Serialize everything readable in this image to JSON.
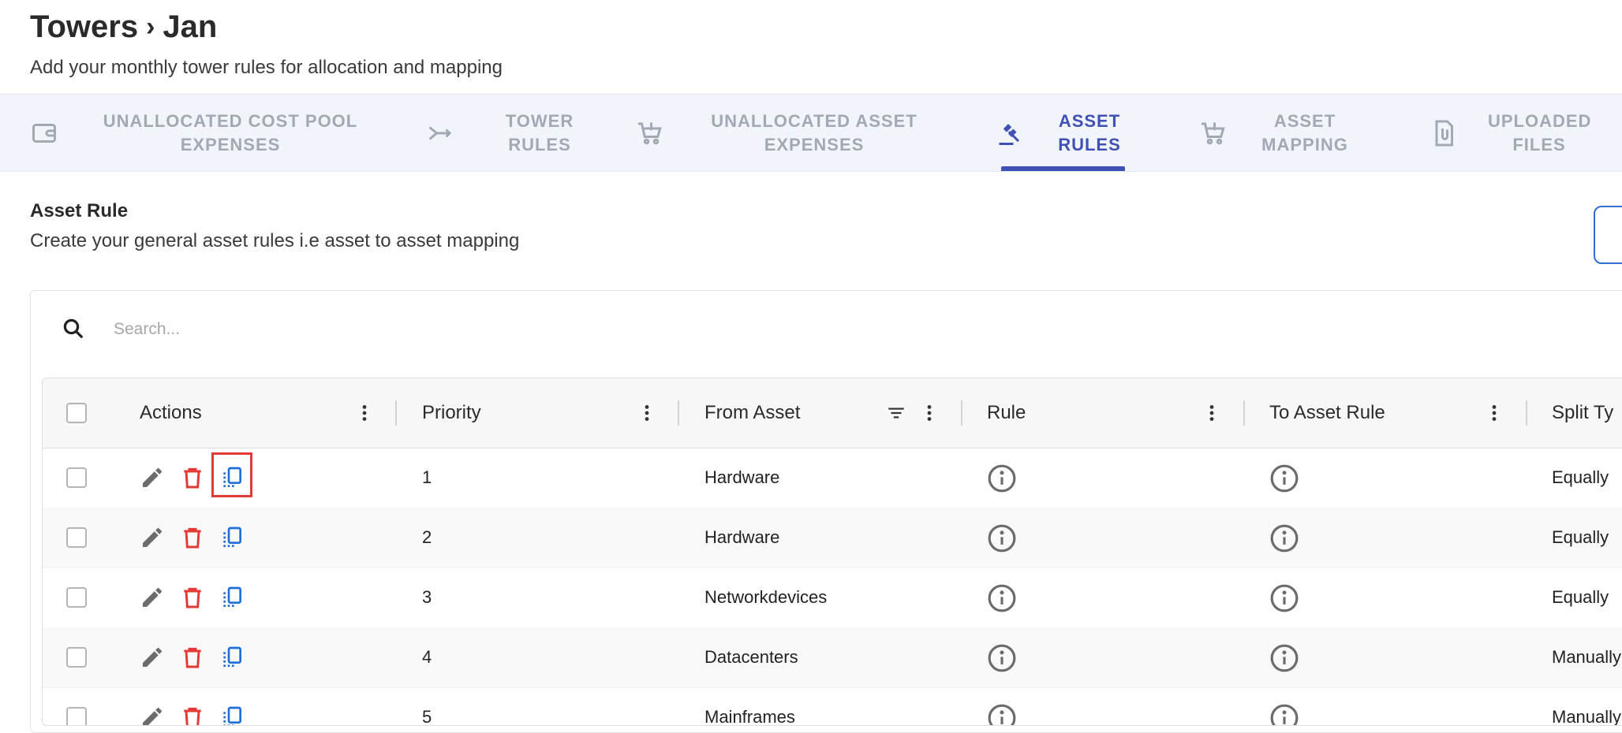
{
  "header": {
    "breadcrumb_parent": "Towers",
    "breadcrumb_separator": "›",
    "breadcrumb_current": "Jan",
    "subtitle": "Add your monthly tower rules for allocation and mapping"
  },
  "tabs": [
    {
      "line1": "UNALLOCATED COST POOL",
      "line2": "EXPENSES",
      "icon": "wallet-icon",
      "active": false
    },
    {
      "line1": "TOWER",
      "line2": "RULES",
      "icon": "merge-arrow-icon",
      "active": false
    },
    {
      "line1": "UNALLOCATED ASSET",
      "line2": "EXPENSES",
      "icon": "cart-alert-icon",
      "active": false
    },
    {
      "line1": "ASSET",
      "line2": "RULES",
      "icon": "gavel-icon",
      "active": true
    },
    {
      "line1": "ASSET",
      "line2": "MAPPING",
      "icon": "cart-alert-icon",
      "active": false
    },
    {
      "line1": "UPLOADED",
      "line2": "FILES",
      "icon": "file-attachment-icon",
      "active": false
    }
  ],
  "section": {
    "title": "Asset Rule",
    "subtitle": "Create your general asset rules i.e asset to asset mapping"
  },
  "search": {
    "placeholder": "Search..."
  },
  "table": {
    "columns": [
      "Actions",
      "Priority",
      "From Asset",
      "Rule",
      "To Asset Rule",
      "Split Ty"
    ],
    "rows": [
      {
        "priority": "1",
        "from_asset": "Hardware",
        "split_type": "Equally"
      },
      {
        "priority": "2",
        "from_asset": "Hardware",
        "split_type": "Equally"
      },
      {
        "priority": "3",
        "from_asset": "Networkdevices",
        "split_type": "Equally"
      },
      {
        "priority": "4",
        "from_asset": "Datacenters",
        "split_type": "Manually"
      },
      {
        "priority": "5",
        "from_asset": "Mainframes",
        "split_type": "Manually"
      }
    ]
  },
  "colors": {
    "accent": "#3f51b5",
    "tab_inactive": "#a3a8b2",
    "delete": "#e53935",
    "copy": "#1e6fd9",
    "edit": "#6b6b6b",
    "highlight": "#e53935"
  }
}
